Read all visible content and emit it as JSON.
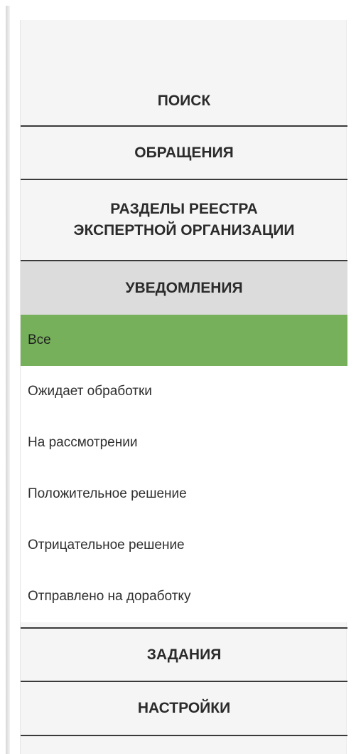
{
  "nav": {
    "search": "ПОИСК",
    "requests": "ОБРАЩЕНИЯ",
    "registry_line1": "РАЗДЕЛЫ РЕЕСТРА",
    "registry_line2": "ЭКСПЕРТНОЙ ОРГАНИЗАЦИИ",
    "notifications": "УВЕДОМЛЕНИЯ",
    "tasks": "ЗАДАНИЯ",
    "settings": "НАСТРОЙКИ"
  },
  "notifications_submenu": {
    "items": [
      "Все",
      "Ожидает обработки",
      "На рассмотрении",
      "Положительное решение",
      "Отрицательное решение",
      "Отправлено на доработку"
    ],
    "selected": "Все"
  },
  "colors": {
    "selected_item": "#76b05a",
    "active_section": "#dcdcdc",
    "divider": "#3a3a3a"
  }
}
